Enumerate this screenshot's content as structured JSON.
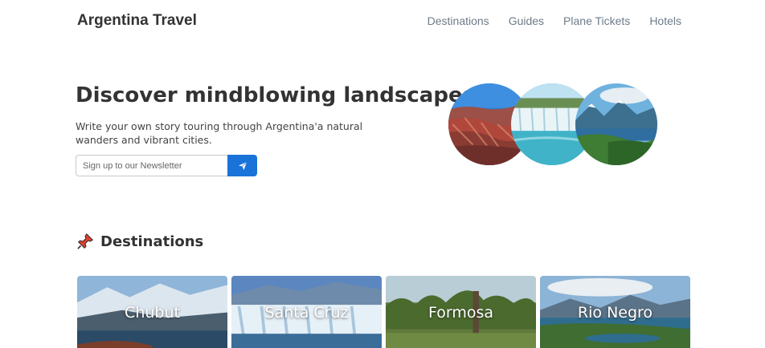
{
  "header": {
    "brand": "Argentina Travel",
    "nav": [
      "Destinations",
      "Guides",
      "Plane Tickets",
      "Hotels"
    ]
  },
  "hero": {
    "title": "Discover mindblowing landscapes",
    "subtitle": "Write your own story touring through Argentina'a natural wanders and vibrant cities.",
    "newsletter_placeholder": "Sign up to our Newsletter",
    "send_icon": "paper-plane-icon",
    "images": [
      "red-mountains-photo",
      "waterfall-photo",
      "lake-mountains-photo"
    ]
  },
  "destinations": {
    "title": "Destinations",
    "title_icon": "pushpin-icon",
    "cards": [
      {
        "label": "Chubut"
      },
      {
        "label": "Santa Cruz"
      },
      {
        "label": "Formosa"
      },
      {
        "label": "Rio Negro"
      }
    ]
  },
  "colors": {
    "accent": "#1a73d9",
    "nav_text": "#6e7b88",
    "heading": "#333333"
  }
}
